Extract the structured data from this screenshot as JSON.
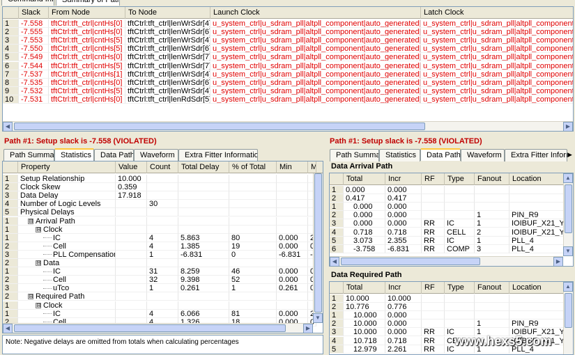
{
  "top_tabs": [
    "Command Info",
    "Summary of Paths"
  ],
  "summary_table": {
    "headers": [
      "",
      "Slack",
      "From Node",
      "To Node",
      "Launch Clock",
      "Latch Clock"
    ],
    "rows": [
      [
        "1",
        "-7.558",
        "tftCtrl:tft_ctrl|cntHs[0]",
        "tftCtrl:tft_ctrl|lenWrSdr[4]",
        "u_system_ctrl|u_sdram_pll|altpll_component|auto_generated|pll1|clk[1]",
        "u_system_ctrl|u_sdram_pll|altpll_component|auto_gen"
      ],
      [
        "2",
        "-7.555",
        "tftCtrl:tft_ctrl|cntHs[0]",
        "tftCtrl:tft_ctrl|lenWrSdr[6]",
        "u_system_ctrl|u_sdram_pll|altpll_component|auto_generated|pll1|clk[1]",
        "u_system_ctrl|u_sdram_pll|altpll_component|auto_gen"
      ],
      [
        "3",
        "-7.553",
        "tftCtrl:tft_ctrl|cntHs[5]",
        "tftCtrl:tft_ctrl|lenWrSdr[4]",
        "u_system_ctrl|u_sdram_pll|altpll_component|auto_generated|pll1|clk[1]",
        "u_system_ctrl|u_sdram_pll|altpll_component|auto_gen"
      ],
      [
        "4",
        "-7.550",
        "tftCtrl:tft_ctrl|cntHs[5]",
        "tftCtrl:tft_ctrl|lenWrSdr[6]",
        "u_system_ctrl|u_sdram_pll|altpll_component|auto_generated|pll1|clk[1]",
        "u_system_ctrl|u_sdram_pll|altpll_component|auto_gen"
      ],
      [
        "5",
        "-7.549",
        "tftCtrl:tft_ctrl|cntHs[0]",
        "tftCtrl:tft_ctrl|lenWrSdr[7]",
        "u_system_ctrl|u_sdram_pll|altpll_component|auto_generated|pll1|clk[1]",
        "u_system_ctrl|u_sdram_pll|altpll_component|auto_gen"
      ],
      [
        "6",
        "-7.544",
        "tftCtrl:tft_ctrl|cntHs[5]",
        "tftCtrl:tft_ctrl|lenWrSdr[7]",
        "u_system_ctrl|u_sdram_pll|altpll_component|auto_generated|pll1|clk[1]",
        "u_system_ctrl|u_sdram_pll|altpll_component|auto_gen"
      ],
      [
        "7",
        "-7.537",
        "tftCtrl:tft_ctrl|cntHs[1]",
        "tftCtrl:tft_ctrl|lenWrSdr[4]",
        "u_system_ctrl|u_sdram_pll|altpll_component|auto_generated|pll1|clk[1]",
        "u_system_ctrl|u_sdram_pll|altpll_component|auto_gen"
      ],
      [
        "8",
        "-7.535",
        "tftCtrl:tft_ctrl|cntHs[0]",
        "tftCtrl:tft_ctrl|lenWrSdr[6]",
        "u_system_ctrl|u_sdram_pll|altpll_component|auto_generated|pll1|clk[1]",
        "u_system_ctrl|u_sdram_pll|altpll_component|auto_gen"
      ],
      [
        "9",
        "-7.532",
        "tftCtrl:tft_ctrl|cntHs[5]",
        "tftCtrl:tft_ctrl|lenWrSdr[4]",
        "u_system_ctrl|u_sdram_pll|altpll_component|auto_generated|pll1|clk[1]",
        "u_system_ctrl|u_sdram_pll|altpll_component|auto_gen"
      ],
      [
        "10",
        "-7.531",
        "tftCtrl:tft_ctrl|cntHs[0]",
        "tftCtrl:tft_ctrl|lenRdSdr[5]",
        "u_system_ctrl|u_sdram_pll|altpll_component|auto_generated|pll1|clk[1]",
        "u_system_ctrl|u_sdram_pll|altpll_component|auto_gen"
      ]
    ]
  },
  "path_title": "Path #1: Setup slack is -7.558 (VIOLATED)",
  "left_tabs": [
    "Path Summary",
    "Statistics",
    "Data Path",
    "Waveform",
    "Extra Fitter Information"
  ],
  "right_tabs": [
    "Path Summary",
    "Statistics",
    "Data Path",
    "Waveform",
    "Extra Fitter Informa"
  ],
  "stats_table": {
    "headers": [
      "",
      "Property",
      "Value",
      "Count",
      "Total Delay",
      "% of Total",
      "Min",
      "M"
    ],
    "rows": [
      {
        "n": "1",
        "prop": "Setup Relationship",
        "indent": 0,
        "tree": "",
        "val": "10.000",
        "count": "",
        "total": "",
        "pct": "",
        "min": "",
        "max": ""
      },
      {
        "n": "2",
        "prop": "Clock Skew",
        "indent": 0,
        "tree": "",
        "val": "0.359",
        "count": "",
        "total": "",
        "pct": "",
        "min": "",
        "max": ""
      },
      {
        "n": "3",
        "prop": "Data Delay",
        "indent": 0,
        "tree": "",
        "val": "17.918",
        "count": "",
        "total": "",
        "pct": "",
        "min": "",
        "max": ""
      },
      {
        "n": "4",
        "prop": "Number of Logic Levels",
        "indent": 0,
        "tree": "",
        "val": "",
        "count": "30",
        "total": "",
        "pct": "",
        "min": "",
        "max": ""
      },
      {
        "n": "5",
        "prop": "Physical Delays",
        "indent": 0,
        "tree": "",
        "val": "",
        "count": "",
        "total": "",
        "pct": "",
        "min": "",
        "max": ""
      },
      {
        "n": "1",
        "prop": "Arrival Path",
        "indent": 1,
        "tree": "⊟",
        "val": "",
        "count": "",
        "total": "",
        "pct": "",
        "min": "",
        "max": ""
      },
      {
        "n": "1",
        "prop": "Clock",
        "indent": 2,
        "tree": "⊟",
        "val": "",
        "count": "",
        "total": "",
        "pct": "",
        "min": "",
        "max": ""
      },
      {
        "n": "1",
        "prop": "IC",
        "indent": 3,
        "tree": "",
        "val": "",
        "count": "4",
        "total": "5.863",
        "pct": "80",
        "min": "0.000",
        "max": "2"
      },
      {
        "n": "2",
        "prop": "Cell",
        "indent": 3,
        "tree": "",
        "val": "",
        "count": "4",
        "total": "1.385",
        "pct": "19",
        "min": "0.000",
        "max": "0"
      },
      {
        "n": "3",
        "prop": "PLL Compensation",
        "indent": 3,
        "tree": "",
        "val": "",
        "count": "1",
        "total": "-6.831",
        "pct": "0",
        "min": "-6.831",
        "max": "-6"
      },
      {
        "n": "2",
        "prop": "Data",
        "indent": 2,
        "tree": "⊟",
        "val": "",
        "count": "",
        "total": "",
        "pct": "",
        "min": "",
        "max": ""
      },
      {
        "n": "1",
        "prop": "IC",
        "indent": 3,
        "tree": "",
        "val": "",
        "count": "31",
        "total": "8.259",
        "pct": "46",
        "min": "0.000",
        "max": "0"
      },
      {
        "n": "2",
        "prop": "Cell",
        "indent": 3,
        "tree": "",
        "val": "",
        "count": "32",
        "total": "9.398",
        "pct": "52",
        "min": "0.000",
        "max": "0"
      },
      {
        "n": "3",
        "prop": "uTco",
        "indent": 3,
        "tree": "",
        "val": "",
        "count": "1",
        "total": "0.261",
        "pct": "1",
        "min": "0.261",
        "max": "0"
      },
      {
        "n": "2",
        "prop": "Required Path",
        "indent": 1,
        "tree": "⊟",
        "val": "",
        "count": "",
        "total": "",
        "pct": "",
        "min": "",
        "max": ""
      },
      {
        "n": "1",
        "prop": "Clock",
        "indent": 2,
        "tree": "⊟",
        "val": "",
        "count": "",
        "total": "",
        "pct": "",
        "min": "",
        "max": ""
      },
      {
        "n": "1",
        "prop": "IC",
        "indent": 3,
        "tree": "",
        "val": "",
        "count": "4",
        "total": "6.066",
        "pct": "81",
        "min": "0.000",
        "max": "2"
      },
      {
        "n": "2",
        "prop": "Cell",
        "indent": 3,
        "tree": "",
        "val": "",
        "count": "4",
        "total": "1.326",
        "pct": "18",
        "min": "0.000",
        "max": "0"
      }
    ]
  },
  "note": "Note: Negative delays are omitted from totals when calculating percentages",
  "arrival": {
    "title": "Data Arrival Path",
    "headers": [
      "",
      "Total",
      "Incr",
      "RF",
      "Type",
      "Fanout",
      "Location"
    ],
    "rows": [
      {
        "n": "1",
        "tot": "0.000",
        "incr": "0.000",
        "rf": "",
        "type": "",
        "fan": "",
        "loc": "",
        "ind": 0
      },
      {
        "n": "2",
        "tot": "0.417",
        "incr": "0.417",
        "rf": "",
        "type": "",
        "fan": "",
        "loc": "",
        "ind": 0
      },
      {
        "n": "1",
        "tot": "0.000",
        "incr": "0.000",
        "rf": "",
        "type": "",
        "fan": "",
        "loc": "",
        "ind": 1
      },
      {
        "n": "2",
        "tot": "0.000",
        "incr": "0.000",
        "rf": "",
        "type": "",
        "fan": "1",
        "loc": "PIN_R9",
        "ind": 1
      },
      {
        "n": "3",
        "tot": "0.000",
        "incr": "0.000",
        "rf": "RR",
        "type": "IC",
        "fan": "1",
        "loc": "IOIBUF_X21_Y0_N",
        "ind": 1
      },
      {
        "n": "4",
        "tot": "0.718",
        "incr": "0.718",
        "rf": "RR",
        "type": "CELL",
        "fan": "2",
        "loc": "IOIBUF_X21_Y0_N",
        "ind": 1
      },
      {
        "n": "5",
        "tot": "3.073",
        "incr": "2.355",
        "rf": "RR",
        "type": "IC",
        "fan": "1",
        "loc": "PLL_4",
        "ind": 1
      },
      {
        "n": "6",
        "tot": "-3.758",
        "incr": "-6.831",
        "rf": "RR",
        "type": "COMP",
        "fan": "3",
        "loc": "PLL_4",
        "ind": 1
      }
    ]
  },
  "required": {
    "title": "Data Required Path",
    "headers": [
      "",
      "Total",
      "Incr",
      "RF",
      "Type",
      "Fanout",
      "Location"
    ],
    "rows": [
      {
        "n": "1",
        "tot": "10.000",
        "incr": "10.000",
        "rf": "",
        "type": "",
        "fan": "",
        "loc": "",
        "ind": 0
      },
      {
        "n": "2",
        "tot": "10.776",
        "incr": "0.776",
        "rf": "",
        "type": "",
        "fan": "",
        "loc": "",
        "ind": 0
      },
      {
        "n": "1",
        "tot": "10.000",
        "incr": "0.000",
        "rf": "",
        "type": "",
        "fan": "",
        "loc": "",
        "ind": 1
      },
      {
        "n": "2",
        "tot": "10.000",
        "incr": "0.000",
        "rf": "",
        "type": "",
        "fan": "1",
        "loc": "PIN_R9",
        "ind": 1
      },
      {
        "n": "3",
        "tot": "10.000",
        "incr": "0.000",
        "rf": "RR",
        "type": "IC",
        "fan": "1",
        "loc": "IOIBUF_X21_Y0_N",
        "ind": 1
      },
      {
        "n": "4",
        "tot": "10.718",
        "incr": "0.718",
        "rf": "RR",
        "type": "CELL",
        "fan": "2",
        "loc": "IOIBUF_X21_Y0_N",
        "ind": 1
      },
      {
        "n": "5",
        "tot": "12.979",
        "incr": "2.261",
        "rf": "RR",
        "type": "IC",
        "fan": "1",
        "loc": "PLL_4",
        "ind": 1
      }
    ]
  },
  "watermark": "www.hexs5.com"
}
